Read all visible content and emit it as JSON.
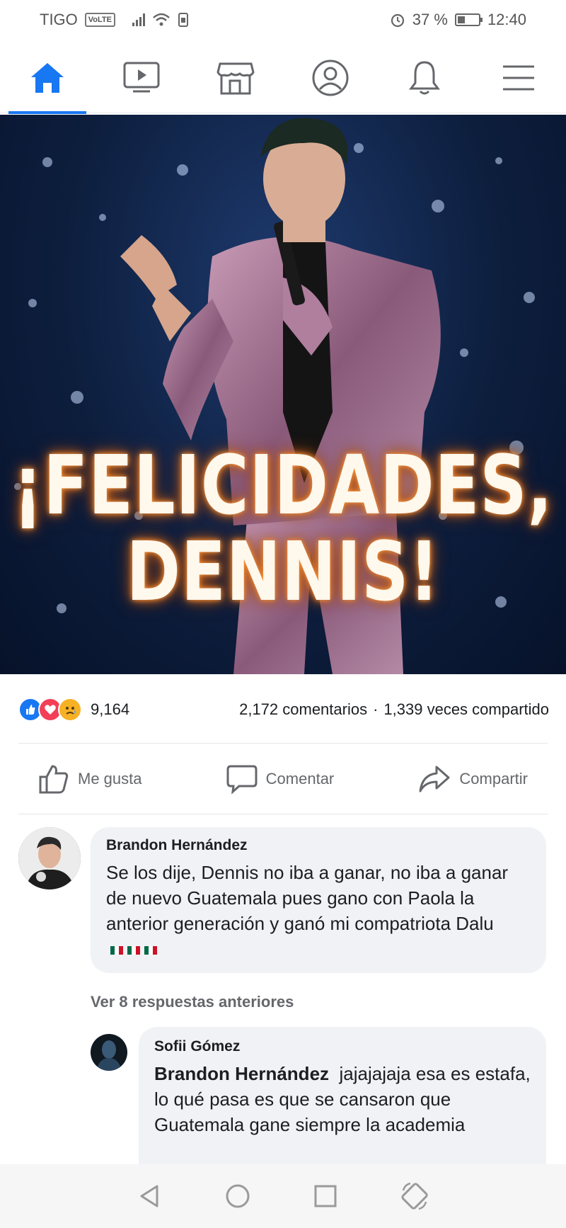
{
  "status": {
    "carrier": "TIGO",
    "volte": "VoLTE",
    "battery_pct": "37 %",
    "time": "12:40"
  },
  "nav": {
    "items": [
      {
        "icon": "home-icon",
        "active": true
      },
      {
        "icon": "video-icon",
        "active": false
      },
      {
        "icon": "marketplace-icon",
        "active": false
      },
      {
        "icon": "profile-icon",
        "active": false
      },
      {
        "icon": "bell-icon",
        "active": false
      },
      {
        "icon": "menu-icon",
        "active": false
      }
    ]
  },
  "post": {
    "image_title_line1": "¡FELICIDADES,",
    "image_title_line2": "DENNIS!",
    "reaction_count": "9,164",
    "comments_count": "2,172 comentarios",
    "separator": "·",
    "shares_count": "1,339 veces compartido"
  },
  "actions": {
    "like": "Me gusta",
    "comment": "Comentar",
    "share": "Compartir"
  },
  "comments": [
    {
      "author": "Brandon Hernández",
      "text": "Se los dije, Dennis no iba a ganar, no iba a ganar de nuevo Guatemala pues gano con Paola la anterior generación y ganó mi compatriota Dalu"
    }
  ],
  "more_replies": "Ver 8 respuestas anteriores",
  "reply": {
    "author": "Sofii Gómez",
    "tag": "Brandon Hernández",
    "text": "jajajajaja esa es estafa, lo qué pasa es que se cansaron que Guatemala gane siempre la academia"
  },
  "colors": {
    "accent": "#1877f2",
    "like": "#1877f2",
    "love": "#f33e58",
    "sad": "#f7b125"
  }
}
